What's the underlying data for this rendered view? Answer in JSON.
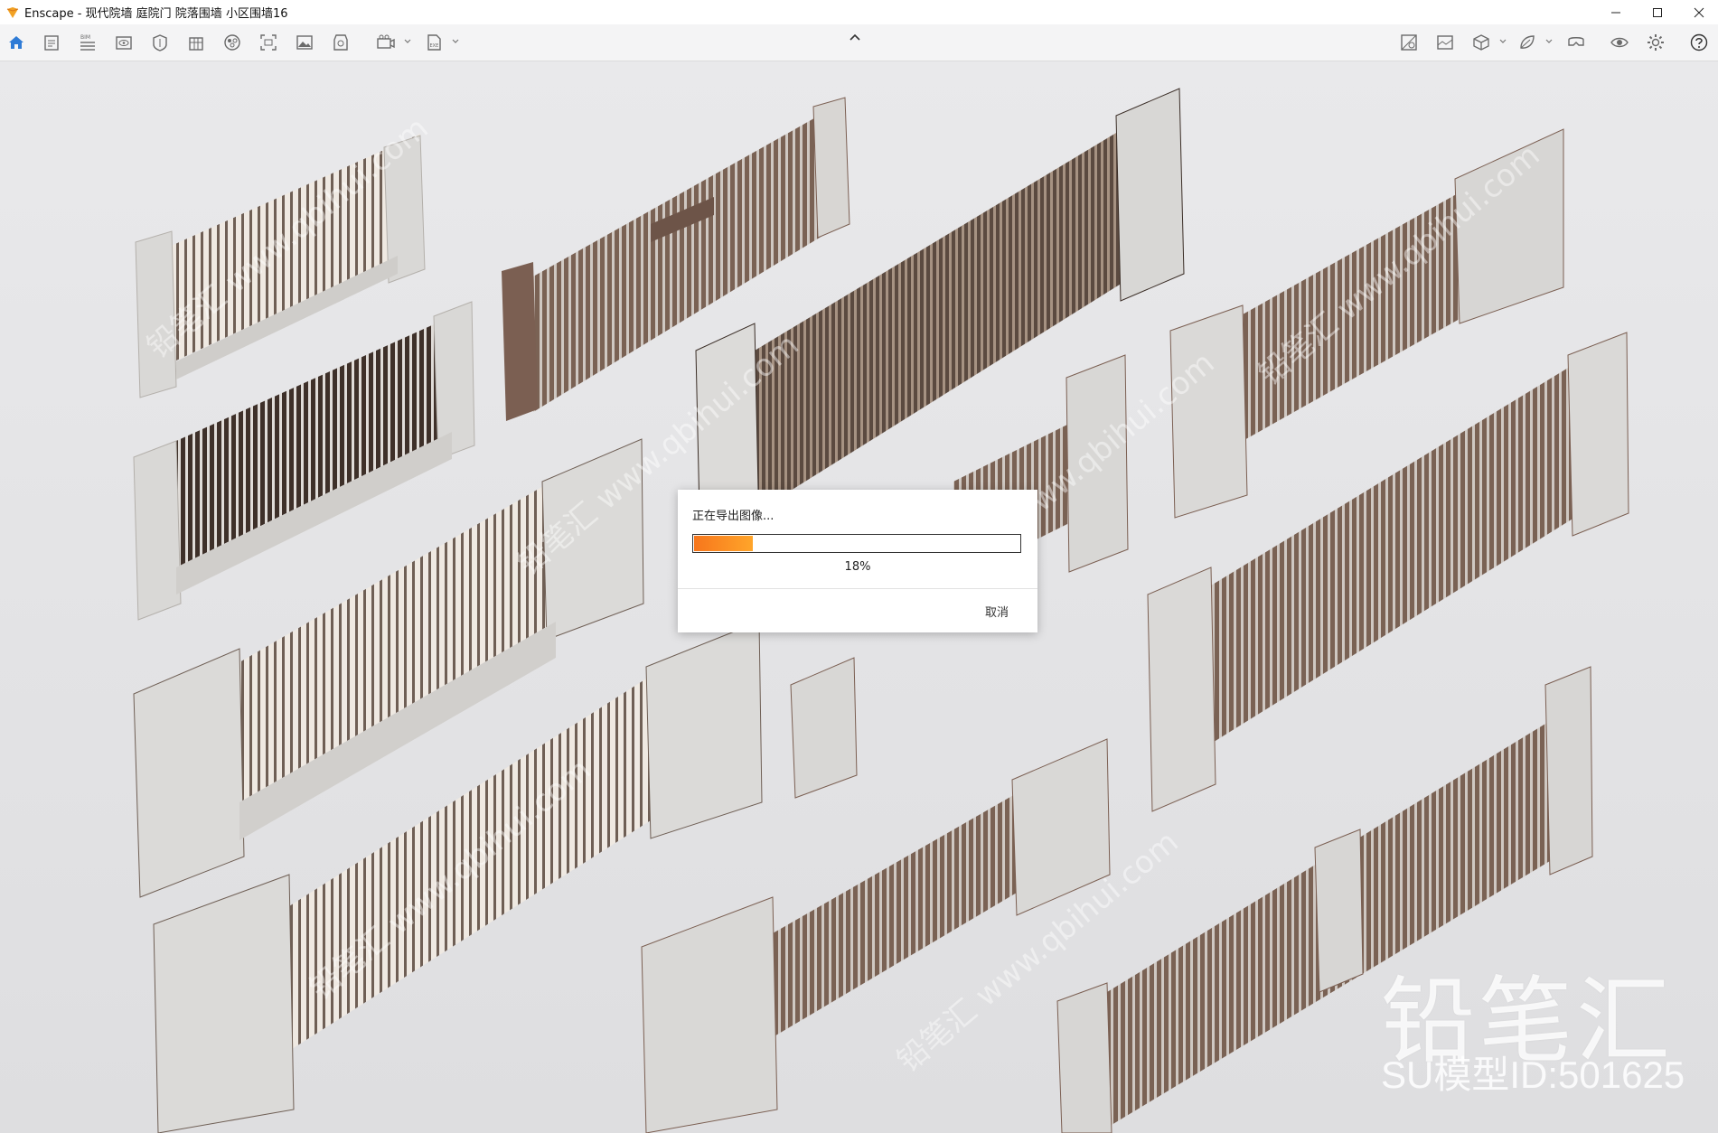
{
  "window": {
    "title": "Enscape - 现代院墙 庭院门 院落围墙 小区围墙16",
    "minimize_icon": "minimize-icon",
    "maximize_icon": "maximize-icon",
    "close_icon": "close-icon"
  },
  "toolbar": {
    "left_icons": [
      "home-icon",
      "notes-icon",
      "bim-icon",
      "view-icon",
      "asset-icon",
      "building-icon",
      "material-icon",
      "screenshot-icon",
      "image-icon",
      "panorama-icon",
      "video-icon",
      "exe-icon"
    ],
    "bim_label": "BIM",
    "collapse_icon": "chevron-up-icon",
    "right_icons": [
      "section-icon",
      "render-icon",
      "cube-icon",
      "atmosphere-icon",
      "vr-icon",
      "visual-settings-icon",
      "settings-icon",
      "help-icon"
    ]
  },
  "scene": {
    "description_icon": "3d-render-viewport"
  },
  "watermark": {
    "brand": "铅笔汇",
    "model_id": "SU模型ID:501625",
    "diagonal_text": "铅笔汇 www.qbihui.com"
  },
  "export_dialog": {
    "title": "正在导出图像...",
    "progress": 0.18,
    "progress_label": "18%",
    "cancel_label": "取消"
  },
  "colors": {
    "accent_orange": "#f7761c",
    "toolbar_blue": "#2f7bd6",
    "bronze": "#7a6254",
    "stone": "#d7d6d4"
  }
}
